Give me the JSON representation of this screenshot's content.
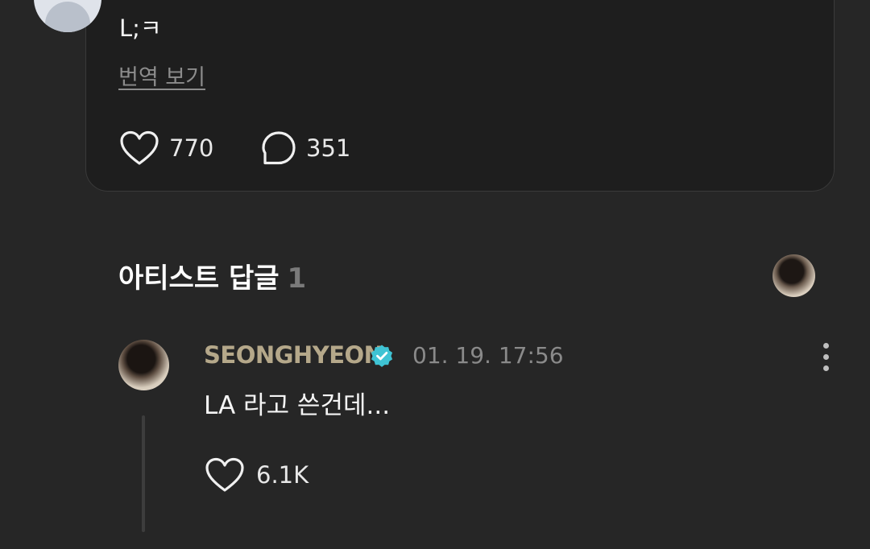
{
  "post": {
    "text": "L;ㅋ",
    "translate_label": "번역 보기",
    "like_count": "770",
    "comment_count": "351"
  },
  "artist_replies": {
    "title": "아티스트 답글",
    "count": "1"
  },
  "reply": {
    "author": "SEONGHYEON",
    "timestamp": "01. 19. 17:56",
    "text": "LA 라고 쓴건데...",
    "like_count": "6.1K"
  },
  "icons": {
    "like": "heart-outline-icon",
    "comment": "speech-bubble-icon",
    "verified": "verified-badge-icon",
    "more": "vertical-dots-icon"
  },
  "colors": {
    "background": "#262626",
    "card": "#1e1e1e",
    "author": "#b5a88a",
    "verified": "#3fc3d4"
  }
}
